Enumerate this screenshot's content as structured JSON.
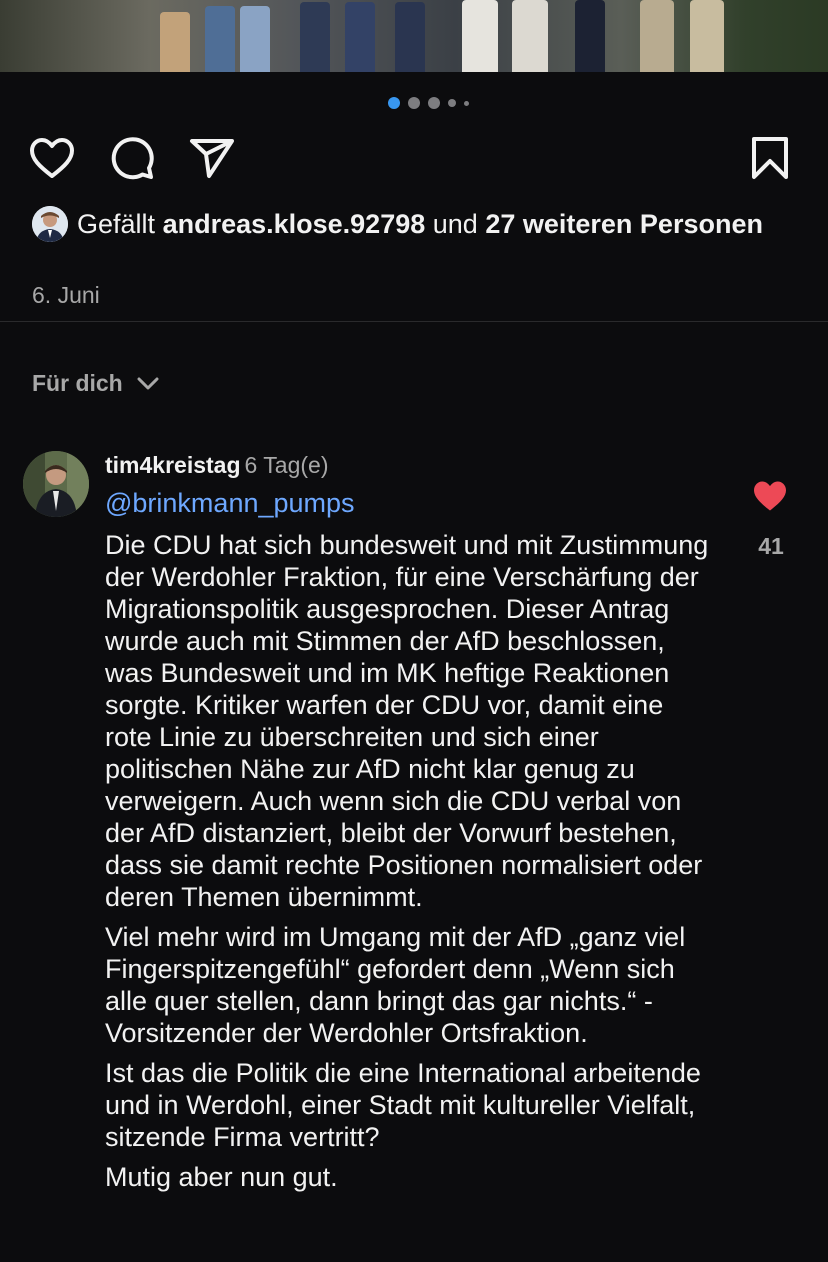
{
  "post": {
    "carousel": {
      "slide_count": 5,
      "active_slide": 1
    },
    "actions": {
      "like_icon": "heart-outline-icon",
      "comment_icon": "comment-bubble-icon",
      "share_icon": "paper-plane-icon",
      "save_icon": "bookmark-icon"
    },
    "likes": {
      "prefix": "Gefällt",
      "user": "andreas.klose.92798",
      "connector": "und",
      "others": "27 weiteren Personen"
    },
    "date": "6. Juni"
  },
  "comments_section": {
    "sort_label": "Für dich",
    "sort_icon": "chevron-down-icon"
  },
  "comment": {
    "username": "tim4kreistag",
    "time": "6 Tag(e)",
    "mention": "@brinkmann_pumps",
    "paragraphs": [
      "Die CDU hat sich bundesweit und mit Zustimmung der Werdohler Fraktion, für eine Verschärfung der Migrationspolitik ausgesprochen. Dieser Antrag wurde auch mit Stimmen der AfD beschlossen, was Bundesweit und im MK heftige Reaktionen sorgte. Kritiker warfen der CDU vor, damit eine rote Linie zu überschreiten und sich einer politischen Nähe zur AfD nicht klar genug zu verweigern. Auch wenn sich die CDU verbal von der AfD distanziert, bleibt der Vorwurf bestehen, dass sie damit rechte Positionen normalisiert oder deren Themen übernimmt.",
      "Viel mehr wird im Umgang mit der AfD „ganz viel Fingerspitzengefühl“ gefordert denn „Wenn sich alle quer stellen, dann bringt das gar nichts.“ -Vorsitzender der Werdohler Ortsfraktion.",
      "Ist das die Politik die eine International arbeitende und in Werdohl, einer Stadt mit kultureller Vielfalt, sitzende Firma vertritt?",
      "Mutig aber nun gut."
    ],
    "like_icon": "heart-filled-icon",
    "like_count": "41",
    "heart_color": "#ed4956"
  },
  "colors": {
    "background": "#0c0c0e",
    "accent": "#3897f0",
    "mention": "#6ea8ff",
    "muted": "#a8a8a8"
  }
}
